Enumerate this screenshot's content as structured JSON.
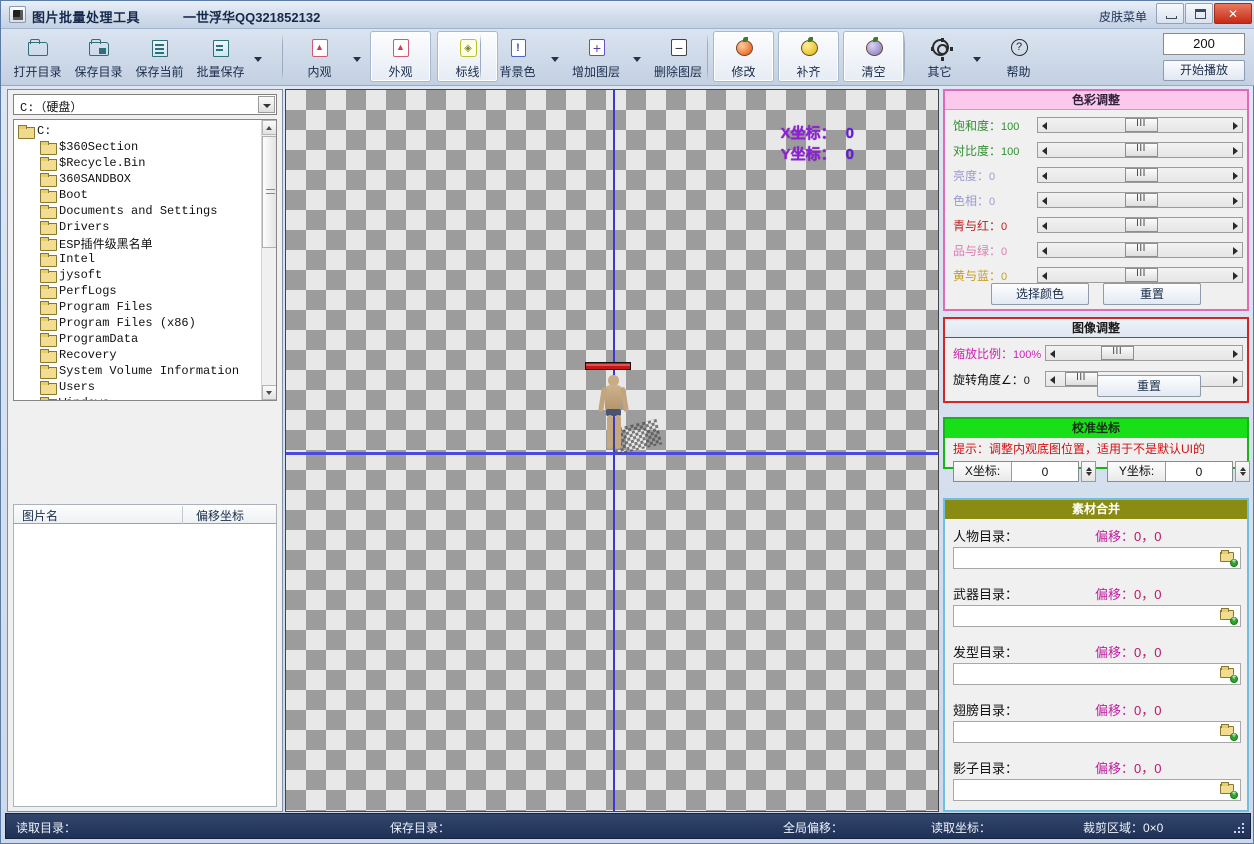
{
  "window": {
    "title": "图片批量处理工具",
    "subtitle": "一世浮华QQ321852132",
    "skin_menu": "皮肤菜单",
    "minimize": "—",
    "maximize": "□",
    "close": "✕"
  },
  "toolbar": {
    "groups": [
      {
        "buttons": [
          {
            "label": "打开目录",
            "icon": "open-folder-icon"
          },
          {
            "label": "保存目录",
            "icon": "save-folder-icon"
          },
          {
            "label": "保存当前",
            "icon": "save-current-icon"
          },
          {
            "label": "批量保存",
            "icon": "batch-save-icon",
            "dropdown": true
          }
        ]
      },
      {
        "buttons": [
          {
            "label": "内观",
            "icon": "inner-view-icon",
            "dropdown": true
          },
          {
            "label": "外观",
            "icon": "outer-view-icon",
            "active": true
          },
          {
            "label": "标线",
            "icon": "guide-line-icon",
            "active": true
          }
        ]
      },
      {
        "buttons": [
          {
            "label": "背景色",
            "icon": "background-color-icon",
            "dropdown": true
          },
          {
            "label": "增加图层",
            "icon": "add-layer-icon",
            "dropdown": true
          },
          {
            "label": "删除图层",
            "icon": "delete-layer-icon"
          }
        ]
      },
      {
        "buttons": [
          {
            "label": "修改",
            "icon": "modify-icon",
            "active": true
          },
          {
            "label": "补齐",
            "icon": "fill-icon",
            "active": true
          },
          {
            "label": "清空",
            "icon": "clear-icon",
            "active": true
          }
        ]
      },
      {
        "buttons": [
          {
            "label": "其它",
            "icon": "gear-icon",
            "dropdown": true
          },
          {
            "label": "帮助",
            "icon": "help-icon"
          }
        ]
      }
    ],
    "play_value": "200",
    "play_button": "开始播放"
  },
  "left_panel": {
    "drive_combo": "C:（硬盘）",
    "tree_root": "C:",
    "tree_items": [
      "$360Section",
      "$Recycle.Bin",
      "360SANDBOX",
      "Boot",
      "Documents and Settings",
      "Drivers",
      "ESP插件级黑名单",
      "Intel",
      "jysoft",
      "PerfLogs",
      "Program Files",
      "Program Files (x86)",
      "ProgramData",
      "Recovery",
      "System Volume Information",
      "Users",
      "Windows"
    ],
    "list_headers": [
      "图片名",
      "偏移坐标"
    ],
    "list_rows": []
  },
  "canvas": {
    "coord_x_label": "X坐标：",
    "coord_x_value": "0",
    "coord_y_label": "Y坐标：",
    "coord_y_value": "0",
    "overlay_color": "#8f1fd6",
    "guide_color": "#3a3ad0"
  },
  "right_panel": {
    "color_adjust": {
      "caption": "色彩调整",
      "header_color": "#fbc9ec",
      "border_color": "#e06ab8",
      "rows": [
        {
          "label": "饱和度：",
          "value": "100",
          "color": "#2f8f2f",
          "thumb_pct": 50
        },
        {
          "label": "对比度：",
          "value": "100",
          "color": "#2f8f2f",
          "thumb_pct": 50
        },
        {
          "label": "亮度：",
          "value": "0",
          "color": "#9a9ad0",
          "thumb_pct": 50
        },
        {
          "label": "色相：",
          "value": "0",
          "color": "#9a9ad0",
          "thumb_pct": 50
        },
        {
          "label": "青与红：",
          "value": "0",
          "color": "#c02020",
          "thumb_pct": 50
        },
        {
          "label": "品与绿：",
          "value": "0",
          "color": "#e07ab0",
          "thumb_pct": 50
        },
        {
          "label": "黄与蓝：",
          "value": "0",
          "color": "#c89a20",
          "thumb_pct": 50
        }
      ],
      "pick_color_button": "选择颜色",
      "reset_button": "重置"
    },
    "image_adjust": {
      "caption": "图像调整",
      "border_color": "#d22727",
      "rows": [
        {
          "label": "缩放比例：",
          "value": "100%",
          "color": "#d020b0",
          "thumb_pct": 30
        },
        {
          "label": "旋转角度∠：",
          "value": "0",
          "color": "#111111",
          "thumb_pct": 4
        }
      ],
      "reset_button": "重置"
    },
    "calibrate": {
      "caption": "校准坐标",
      "header_color": "#18e018",
      "hint": "提示：调整内观底图位置，适用于不是默认UI的",
      "x_label": "X坐标:",
      "x_value": "0",
      "y_label": "Y坐标:",
      "y_value": "0"
    },
    "merge": {
      "caption": "素材合并",
      "header_color": "#8a8b12",
      "rows": [
        {
          "label": "人物目录：",
          "offset_label": "偏移：",
          "offset_value": "0，0",
          "path": ""
        },
        {
          "label": "武器目录：",
          "offset_label": "偏移：",
          "offset_value": "0，0",
          "path": ""
        },
        {
          "label": "发型目录：",
          "offset_label": "偏移：",
          "offset_value": "0，0",
          "path": ""
        },
        {
          "label": "翅膀目录：",
          "offset_label": "偏移：",
          "offset_value": "0，0",
          "path": ""
        },
        {
          "label": "影子目录：",
          "offset_label": "偏移：",
          "offset_value": "0，0",
          "path": ""
        }
      ]
    }
  },
  "status_bar": {
    "read_dir": "读取目录：",
    "save_dir": "保存目录：",
    "global_offset": "全局偏移：",
    "read_coord": "读取坐标：",
    "crop_area": "裁剪区域：0×0"
  }
}
